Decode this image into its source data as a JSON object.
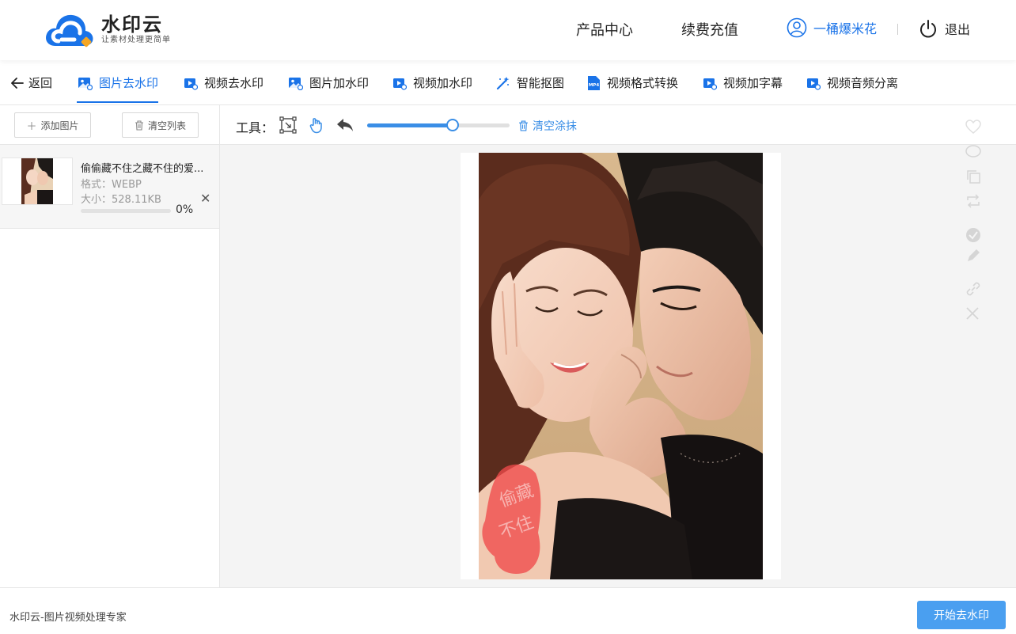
{
  "brand": {
    "name": "水印云",
    "slogan": "让素材处理更简单",
    "accent": "#1a73e8"
  },
  "header": {
    "nav": [
      "产品中心",
      "续费充值"
    ],
    "username": "一桶爆米花",
    "logout": "退出"
  },
  "tabs": {
    "back": "返回",
    "items": [
      {
        "label": "图片去水印",
        "icon": "image-remove-icon",
        "active": true
      },
      {
        "label": "视频去水印",
        "icon": "video-remove-icon"
      },
      {
        "label": "图片加水印",
        "icon": "image-add-icon"
      },
      {
        "label": "视频加水印",
        "icon": "video-add-icon"
      },
      {
        "label": "智能抠图",
        "icon": "magic-wand-icon"
      },
      {
        "label": "视频格式转换",
        "icon": "mp4-icon"
      },
      {
        "label": "视频加字幕",
        "icon": "video-subtitle-icon"
      },
      {
        "label": "视频音频分离",
        "icon": "video-audio-icon"
      }
    ]
  },
  "left_panel": {
    "add_button": "添加图片",
    "clear_button": "清空列表",
    "files": [
      {
        "name": "偷偷藏不住之藏不住的爱...",
        "format": "格式：WEBP",
        "size": "大小：528.11KB",
        "progress": 0,
        "progress_text": "0%"
      }
    ]
  },
  "toolbar": {
    "label": "工具：",
    "brush_size": 0.6,
    "clear_paint": "清空涂抹"
  },
  "footer": {
    "text": "水印云-图片视频处理专家",
    "start_button": "开始去水印"
  }
}
